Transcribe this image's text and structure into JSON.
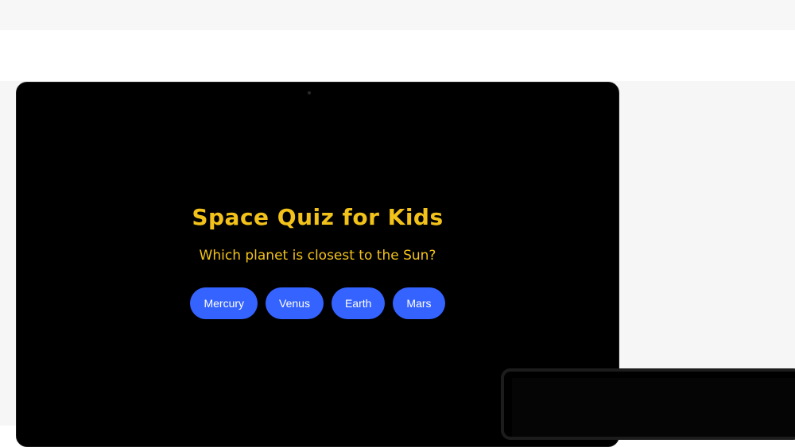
{
  "quiz": {
    "title": "Space Quiz for Kids",
    "question": "Which planet is closest to the Sun?",
    "answers": [
      {
        "label": "Mercury"
      },
      {
        "label": "Venus"
      },
      {
        "label": "Earth"
      },
      {
        "label": "Mars"
      }
    ]
  },
  "colors": {
    "title": "#f2c21a",
    "button": "#3563ff",
    "screen": "#000000"
  }
}
